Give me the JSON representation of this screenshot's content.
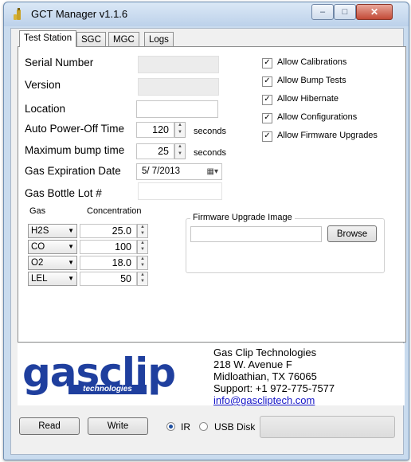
{
  "window": {
    "title": "GCT Manager v1.1.6",
    "close_glyph": "✕",
    "min_glyph": "–",
    "max_glyph": "□"
  },
  "tabs": [
    {
      "label": "Test Station"
    },
    {
      "label": "SGC"
    },
    {
      "label": "MGC"
    },
    {
      "label": "Logs"
    }
  ],
  "form": {
    "serial_number_label": "Serial Number",
    "version_label": "Version",
    "location_label": "Location",
    "auto_power_off_label": "Auto Power-Off Time",
    "auto_power_off_value": "120",
    "max_bump_label": "Maximum bump time",
    "max_bump_value": "25",
    "seconds": "seconds",
    "gas_exp_label": "Gas Expiration Date",
    "gas_exp_value": "5/  7/2013",
    "bottle_lot_label": "Gas Bottle Lot #"
  },
  "gas_table": {
    "col_gas": "Gas",
    "col_conc": "Concentration",
    "rows": [
      {
        "gas": "H2S",
        "value": "25.0"
      },
      {
        "gas": "CO",
        "value": "100"
      },
      {
        "gas": "O2",
        "value": "18.0"
      },
      {
        "gas": "LEL",
        "value": "50"
      }
    ]
  },
  "checkboxes": [
    {
      "label": "Allow Calibrations",
      "checked": true
    },
    {
      "label": "Allow Bump Tests",
      "checked": true
    },
    {
      "label": "Allow Hibernate",
      "checked": true
    },
    {
      "label": "Allow Configurations",
      "checked": true
    },
    {
      "label": "Allow Firmware Upgrades",
      "checked": true
    }
  ],
  "check_glyph": "✓",
  "firmware": {
    "group_label": "Firmware Upgrade Image",
    "browse_label": "Browse"
  },
  "logo": {
    "top": "gasclip",
    "sub": "technologies"
  },
  "company": {
    "name": "Gas Clip Technologies",
    "street": "218 W. Avenue F",
    "city": "Midloathian,  TX  76065",
    "support": "Support:  +1  972-775-7577",
    "email": "info@gascliptech.com"
  },
  "bottom": {
    "read_label": "Read",
    "write_label": "Write",
    "ir_label": "IR",
    "usb_label": "USB Disk",
    "selected": "IR"
  },
  "colors": {
    "logo_blue": "#1f3f9e",
    "link_blue": "#1515c8"
  }
}
